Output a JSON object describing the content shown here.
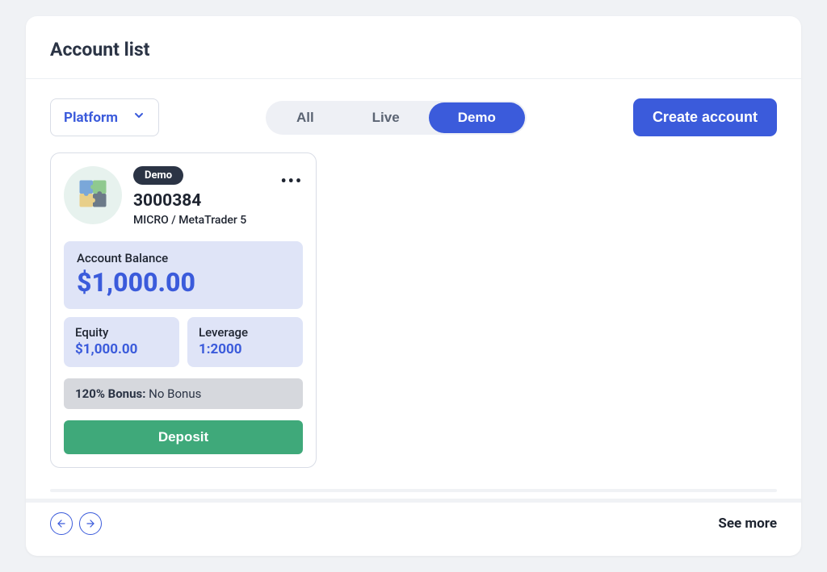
{
  "header": {
    "title": "Account list"
  },
  "filter": {
    "label": "Platform"
  },
  "tabs": {
    "all": "All",
    "live": "Live",
    "demo": "Demo",
    "active": "demo"
  },
  "actions": {
    "create": "Create account"
  },
  "card": {
    "badge": "Demo",
    "account_number": "3000384",
    "meta": "MICRO / MetaTrader 5",
    "balance_label": "Account Balance",
    "balance_value": "$1,000.00",
    "equity_label": "Equity",
    "equity_value": "$1,000.00",
    "leverage_label": "Leverage",
    "leverage_value": "1:2000",
    "bonus_label": "120% Bonus:",
    "bonus_value": "No Bonus",
    "deposit": "Deposit"
  },
  "footer": {
    "see_more": "See more"
  }
}
